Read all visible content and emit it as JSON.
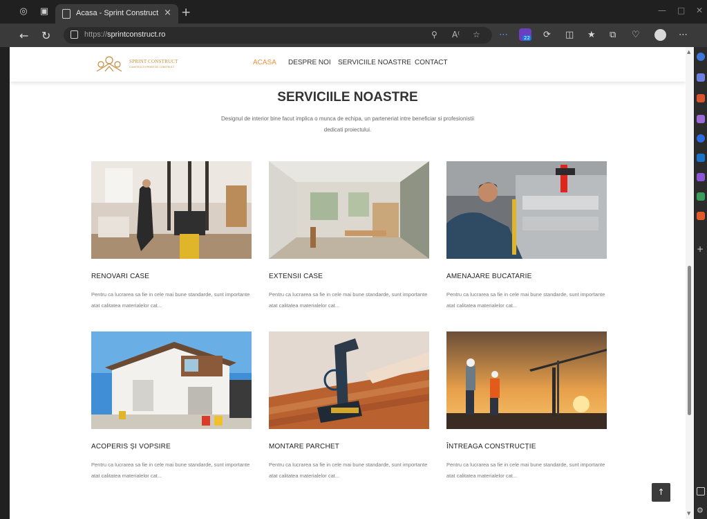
{
  "browser": {
    "tab_title": "Acasa - Sprint Construct",
    "tab_close": "×",
    "new_tab": "+",
    "url_scheme": "https://",
    "url_host": "sprintconstruct.ro",
    "extension_badge": "22"
  },
  "site": {
    "logo_name": "SPRINT CONSTRUCT",
    "logo_tagline": "CONSTRUCTII PRIMITIVE CONSTRUCT",
    "nav": [
      "ACASA",
      "DESPRE NOI",
      "SERVICIILE NOASTRE",
      "CONTACT"
    ],
    "active_nav": "ACASA",
    "accent_color": "#f1923a"
  },
  "services": {
    "title": "SERVICIILE NOASTRE",
    "subtitle": "Designul de interior bine facut implica o munca de echipa, un parteneriat intre beneficiar si profesionistii dedicati proiectului.",
    "cards": [
      {
        "title": "RENOVARI CASE",
        "text": "Pentru ca lucrarea sa fie in cele mai bune standarde, sunt importante atat calitatea materialelor cat..."
      },
      {
        "title": "EXTENSII CASE",
        "text": "Pentru ca lucrarea sa fie in cele mai bune standarde, sunt importante atat calitatea materialelor cat..."
      },
      {
        "title": "AMENAJARE BUCATARIE",
        "text": "Pentru ca lucrarea sa fie in cele mai bune standarde, sunt importante atat calitatea materialelor cat..."
      },
      {
        "title": "ACOPERIS ȘI VOPSIRE",
        "text": "Pentru ca lucrarea sa fie in cele mai bune standarde, sunt importante atat calitatea materialelor cat..."
      },
      {
        "title": "MONTARE PARCHET",
        "text": "Pentru ca lucrarea sa fie in cele mai bune standarde, sunt importante atat calitatea materialelor cat..."
      },
      {
        "title": "ÎNTREAGA CONSTRUCȚIE",
        "text": "Pentru ca lucrarea sa fie in cele mai bune standarde, sunt importante atat calitatea materialelor cat..."
      }
    ]
  },
  "back_to_top": "↑"
}
